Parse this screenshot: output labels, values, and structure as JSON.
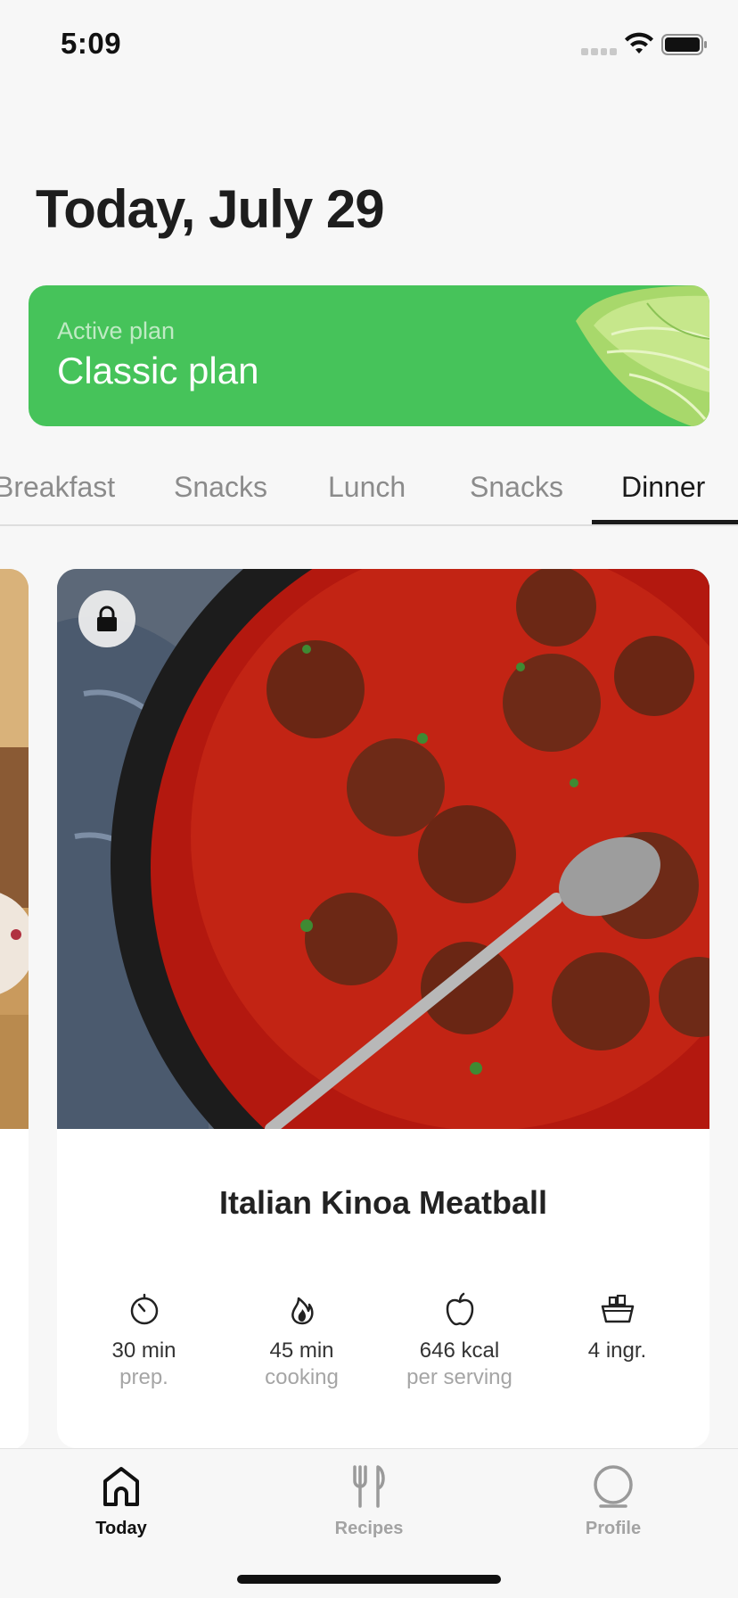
{
  "status_bar": {
    "time": "5:09"
  },
  "header": {
    "title": "Today, July 29"
  },
  "plan": {
    "label": "Active plan",
    "name": "Classic plan",
    "color": "#46c35a"
  },
  "meal_tabs": [
    {
      "label": "Breakfast",
      "active": false
    },
    {
      "label": "Snacks",
      "active": false
    },
    {
      "label": "Lunch",
      "active": false
    },
    {
      "label": "Snacks",
      "active": false
    },
    {
      "label": "Dinner",
      "active": true
    }
  ],
  "recipe": {
    "title": "Italian Kinoa Meatball",
    "locked": true,
    "stats": [
      {
        "icon": "timer-icon",
        "value": "30 min",
        "label": "prep."
      },
      {
        "icon": "flame-icon",
        "value": "45 min",
        "label": "cooking"
      },
      {
        "icon": "apple-icon",
        "value": "646 kcal",
        "label": "per serving"
      },
      {
        "icon": "basket-icon",
        "value": "4 ingr.",
        "label": ""
      }
    ]
  },
  "tab_bar": {
    "items": [
      {
        "label": "Today",
        "icon": "home-icon",
        "active": true
      },
      {
        "label": "Recipes",
        "icon": "utensils-icon",
        "active": false
      },
      {
        "label": "Profile",
        "icon": "profile-icon",
        "active": false
      }
    ]
  }
}
